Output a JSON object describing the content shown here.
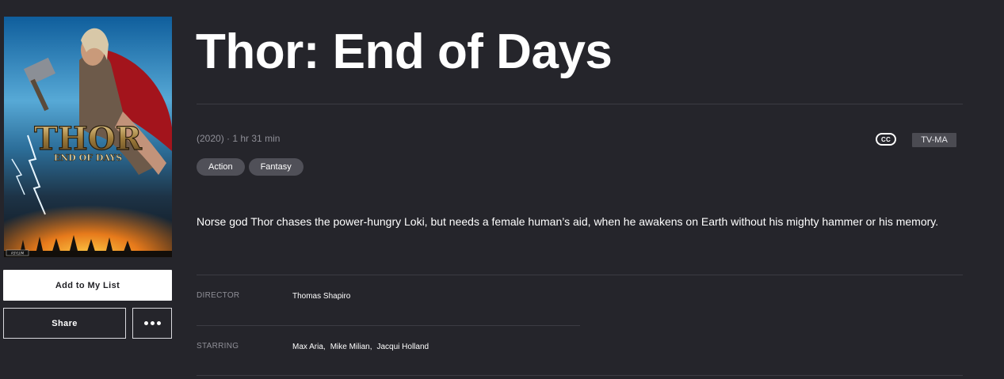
{
  "movie": {
    "title": "Thor: End of Days",
    "year": "(2020)",
    "separator": "·",
    "runtime": "1 hr 31 min",
    "cc_badge": "CC",
    "rating": "TV-MA",
    "genres": [
      "Action",
      "Fantasy"
    ],
    "description": "Norse god Thor chases the power-hungry Loki, but needs a female human’s aid, when he awakens on Earth without his mighty hammer or his memory."
  },
  "poster": {
    "title_text": "THOR",
    "subtitle_text": "END OF DAYS",
    "studio_mark": "ASYLUM"
  },
  "actions": {
    "add_label": "Add to My List",
    "share_label": "Share",
    "more_icon": "more-horizontal-icon"
  },
  "credits": {
    "director_label": "DIRECTOR",
    "director": "Thomas Shapiro",
    "starring_label": "STARRING",
    "starring": [
      "Max Aria,",
      "Mike Milian,",
      "Jacqui Holland"
    ]
  },
  "colors": {
    "background": "#25252b",
    "tag": "#505058",
    "rating_bg": "#4b4b52"
  }
}
